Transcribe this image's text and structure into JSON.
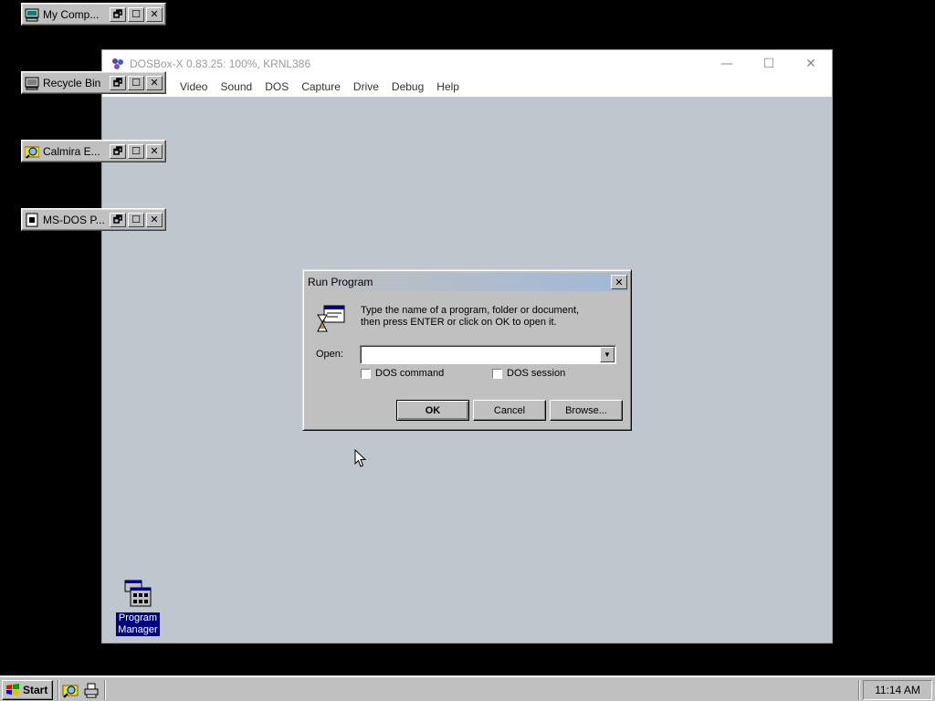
{
  "minimized_windows": [
    {
      "title": "My Comp...",
      "icon": "computer-icon"
    },
    {
      "title": "Recycle Bin",
      "icon": "recycle-bin-icon"
    },
    {
      "title": "Calmira E...",
      "icon": "explorer-icon"
    },
    {
      "title": "MS-DOS P...",
      "icon": "msdos-prompt-icon"
    }
  ],
  "host": {
    "title": "DOSBox-X 0.83.25: 100%, KRNL386",
    "menu": [
      "Video",
      "Sound",
      "DOS",
      "Capture",
      "Drive",
      "Debug",
      "Help"
    ]
  },
  "dialog": {
    "title": "Run Program",
    "message_line1": "Type the name of a program, folder or document,",
    "message_line2": "then press ENTER or click on OK to open it.",
    "open_label": "Open:",
    "open_value": "",
    "dos_command_label": "DOS command",
    "dos_session_label": "DOS session",
    "ok_label": "OK",
    "cancel_label": "Cancel",
    "browse_label": "Browse..."
  },
  "desktop_icon": {
    "label_line1": "Program",
    "label_line2": "Manager"
  },
  "taskbar": {
    "start_label": "Start",
    "clock": "11:14 AM"
  }
}
